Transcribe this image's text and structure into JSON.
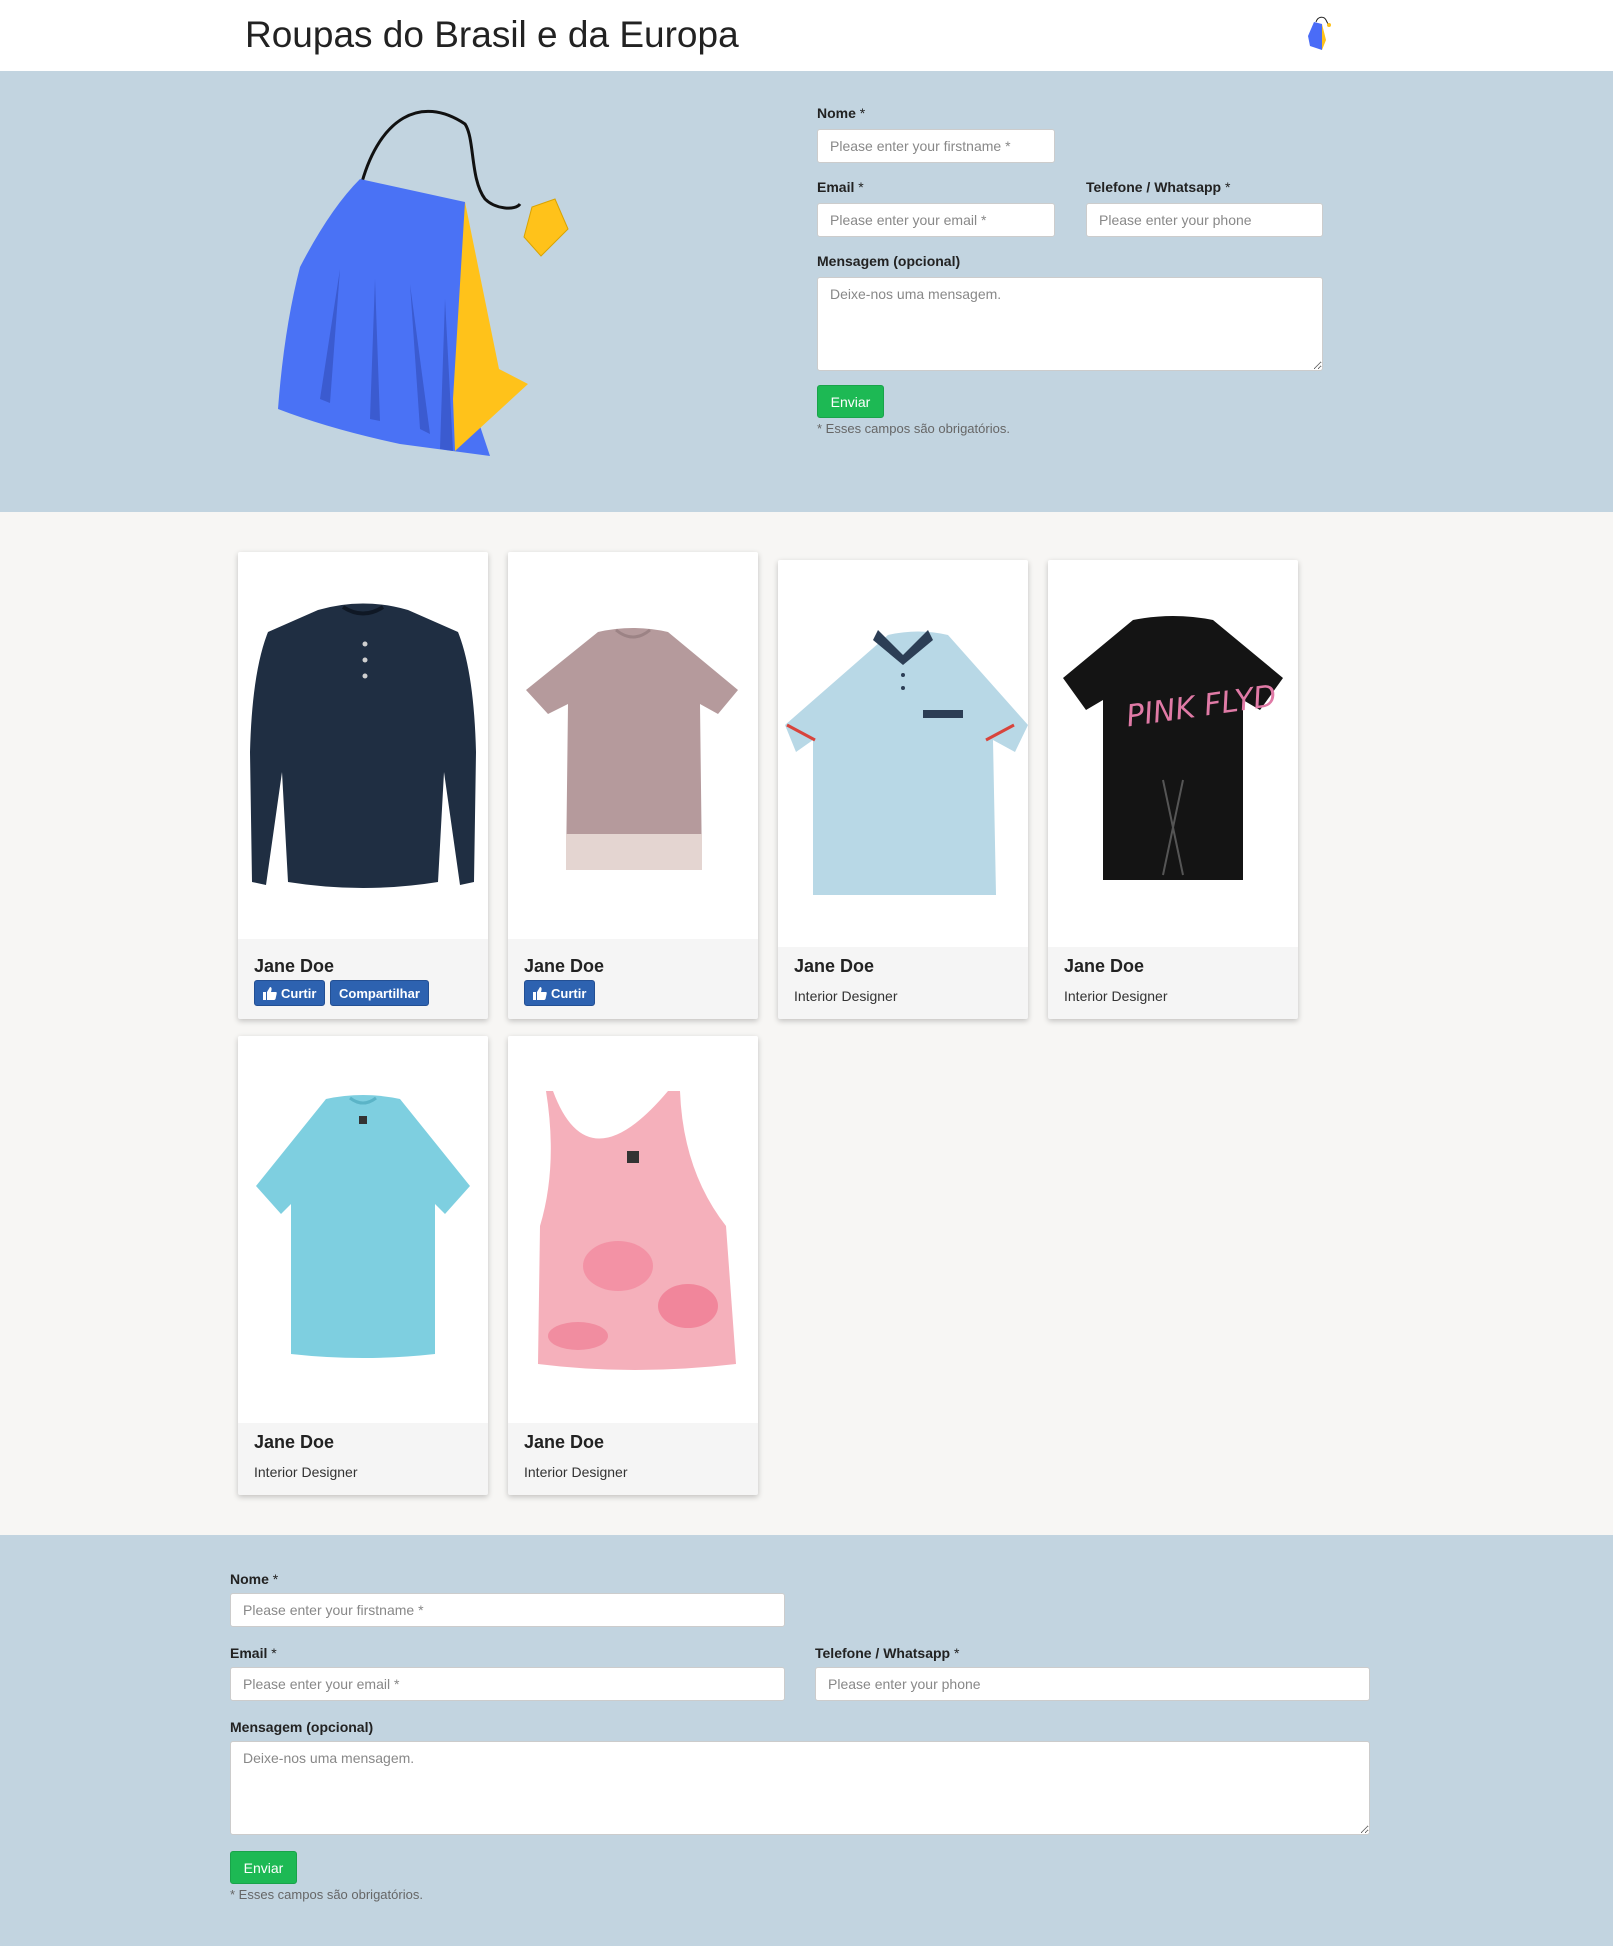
{
  "header": {
    "title": "Roupas do Brasil e da Europa",
    "logo_icon": "shopping-bag-logo-icon"
  },
  "colors": {
    "hero_bg": "#c2d4e0",
    "send_button": "#1db954",
    "fb_button": "#2d62b0"
  },
  "hero_form": {
    "name_label": "Nome",
    "name_placeholder": "Please enter your firstname *",
    "email_label": "Email",
    "email_placeholder": "Please enter your email *",
    "phone_label": "Telefone / Whatsapp",
    "phone_placeholder": "Please enter your phone",
    "message_label": "Mensagem (opcional)",
    "message_placeholder": "Deixe-nos uma mensagem.",
    "required_mark": "*",
    "send_label": "Enviar",
    "note": "* Esses campos são obrigatórios."
  },
  "cards": [
    {
      "name": "Jane Doe",
      "like_label": "Curtir",
      "share_label": "Compartilhar",
      "image_icon": "navy-henley-shirt-icon"
    },
    {
      "name": "Jane Doe",
      "like_label": "Curtir",
      "image_icon": "mauve-tshirt-icon"
    },
    {
      "name": "Jane Doe",
      "role": "Interior Designer",
      "image_icon": "light-blue-polo-icon"
    },
    {
      "name": "Jane Doe",
      "role": "Interior Designer",
      "image_icon": "pink-floyd-tshirt-icon"
    },
    {
      "name": "Jane Doe",
      "role": "Interior Designer",
      "image_icon": "turquoise-tshirt-icon"
    },
    {
      "name": "Jane Doe",
      "role": "Interior Designer",
      "image_icon": "pink-tie-dye-tank-icon"
    }
  ],
  "footer_form": {
    "name_label": "Nome",
    "name_placeholder": "Please enter your firstname *",
    "email_label": "Email",
    "email_placeholder": "Please enter your email *",
    "phone_label": "Telefone / Whatsapp",
    "phone_placeholder": "Please enter your phone",
    "message_label": "Mensagem (opcional)",
    "message_placeholder": "Deixe-nos uma mensagem.",
    "required_mark": "*",
    "send_label": "Enviar",
    "note": "* Esses campos são obrigatórios."
  }
}
